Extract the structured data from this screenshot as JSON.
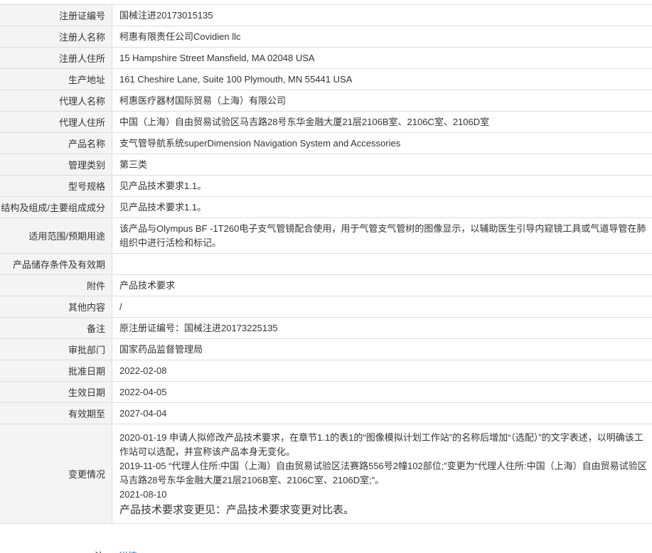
{
  "rows": [
    {
      "label": "注册证编号",
      "value": "国械注进20173015135"
    },
    {
      "label": "注册人名称",
      "value": "柯惠有限责任公司Covidien llc"
    },
    {
      "label": "注册人住所",
      "value": "15 Hampshire Street Mansfield, MA 02048 USA"
    },
    {
      "label": "生产地址",
      "value": "161 Cheshire Lane, Suite 100 Plymouth, MN 55441 USA"
    },
    {
      "label": "代理人名称",
      "value": "柯惠医疗器材国际贸易（上海）有限公司"
    },
    {
      "label": "代理人住所",
      "value": "中国（上海）自由贸易试验区马吉路28号东华金融大厦21层2106B室、2106C室、2106D室"
    },
    {
      "label": "产品名称",
      "value": "支气管导航系统superDimension Navigation System and Accessories"
    },
    {
      "label": "管理类别",
      "value": "第三类"
    },
    {
      "label": "型号规格",
      "value": "见产品技术要求1.1。"
    },
    {
      "label": "结构及组成/主要组成成分",
      "value": "见产品技术要求1.1。"
    },
    {
      "label": "适用范围/预期用途",
      "value": "该产品与Olympus BF -1T260电子支气管镜配合使用，用于气管支气管树的图像显示，以辅助医生引导内窥镜工具或气道导管在肺组织中进行活检和标记。"
    },
    {
      "label": "产品储存条件及有效期",
      "value": ""
    },
    {
      "label": "附件",
      "value": "产品技术要求"
    },
    {
      "label": "其他内容",
      "value": "/"
    },
    {
      "label": "备注",
      "value": "原注册证编号：国械注进20173225135"
    },
    {
      "label": "审批部门",
      "value": "国家药品监督管理局"
    },
    {
      "label": "批准日期",
      "value": "2022-02-08"
    },
    {
      "label": "生效日期",
      "value": "2022-04-05"
    },
    {
      "label": "有效期至",
      "value": "2027-04-04"
    }
  ],
  "change": {
    "label": "变更情况",
    "entries": [
      "2020-01-19 申请人拟修改产品技术要求，在章节1.1的表1的“图像模拟计划工作站”的名称后增加“（选配）”的文字表述，以明确该工作站可以选配，并宣称该产品本身无变化。",
      "2019-11-05 “代理人住所:中国（上海）自由贸易试验区法赛路556号2幢102部位;”变更为“代理人住所:中国（上海）自由贸易试验区马吉路28号东华金融大厦21层2106B室、2106C室、2106D室;”。",
      "2021-08-10"
    ],
    "note": "产品技术要求变更见：产品技术要求变更对比表。"
  },
  "partial_row": {
    "label": "●注",
    "link": "详情"
  }
}
